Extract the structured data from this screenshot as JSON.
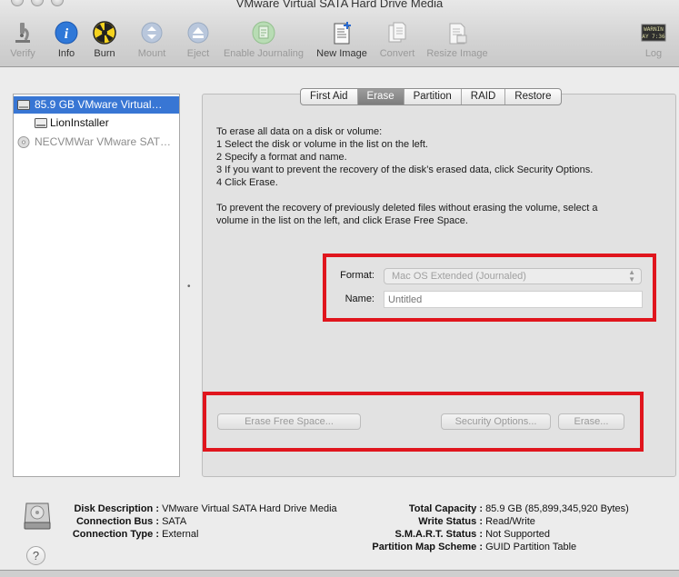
{
  "window": {
    "title": "VMware Virtual SATA Hard Drive Media"
  },
  "toolbar": {
    "verify": "Verify",
    "info": "Info",
    "burn": "Burn",
    "mount": "Mount",
    "eject": "Eject",
    "enable_journaling": "Enable Journaling",
    "new_image": "New Image",
    "convert": "Convert",
    "resize_image": "Resize Image",
    "log": "Log",
    "log_icon_text": "WARNIN\nAY 7:36"
  },
  "sidebar": {
    "items": [
      {
        "label": "85.9 GB VMware Virtual…",
        "icon": "hard-disk-icon",
        "selected": true
      },
      {
        "label": "LionInstaller",
        "icon": "volume-icon"
      },
      {
        "label": "NECVMWar VMware SAT…",
        "icon": "cd-icon",
        "dimmed": true
      }
    ]
  },
  "tabs": {
    "first_aid": "First Aid",
    "erase": "Erase",
    "partition": "Partition",
    "raid": "RAID",
    "restore": "Restore",
    "active": "Erase"
  },
  "instructions": {
    "line1": "To erase all data on a disk or volume:",
    "line2": "1 Select the disk or volume in the list on the left.",
    "line3": "2 Specify a format and name.",
    "line4": "3 If you want to prevent the recovery of the disk’s erased data, click Security Options.",
    "line5": "4 Click Erase.",
    "line6": "To prevent the recovery of previously deleted files without erasing the volume, select a",
    "line7": "volume in the list on the left, and click Erase Free Space."
  },
  "form": {
    "format_label": "Format:",
    "format_value": "Mac OS Extended (Journaled)",
    "name_label": "Name:",
    "name_placeholder": "Untitled"
  },
  "buttons": {
    "erase_free_space": "Erase Free Space...",
    "security_options": "Security Options...",
    "erase": "Erase..."
  },
  "details": {
    "disk_description_label": "Disk Description :",
    "disk_description": "VMware Virtual SATA Hard Drive Media",
    "connection_bus_label": "Connection Bus :",
    "connection_bus": "SATA",
    "connection_type_label": "Connection Type :",
    "connection_type": "External",
    "total_capacity_label": "Total Capacity :",
    "total_capacity": "85.9 GB (85,899,345,920 Bytes)",
    "write_status_label": "Write Status :",
    "write_status": "Read/Write",
    "smart_status_label": "S.M.A.R.T. Status :",
    "smart_status": "Not Supported",
    "partition_map_label": "Partition Map Scheme :",
    "partition_map": "GUID Partition Table"
  },
  "help": "?",
  "colors": {
    "selection": "#3876d4",
    "annotation": "#e0151d"
  }
}
